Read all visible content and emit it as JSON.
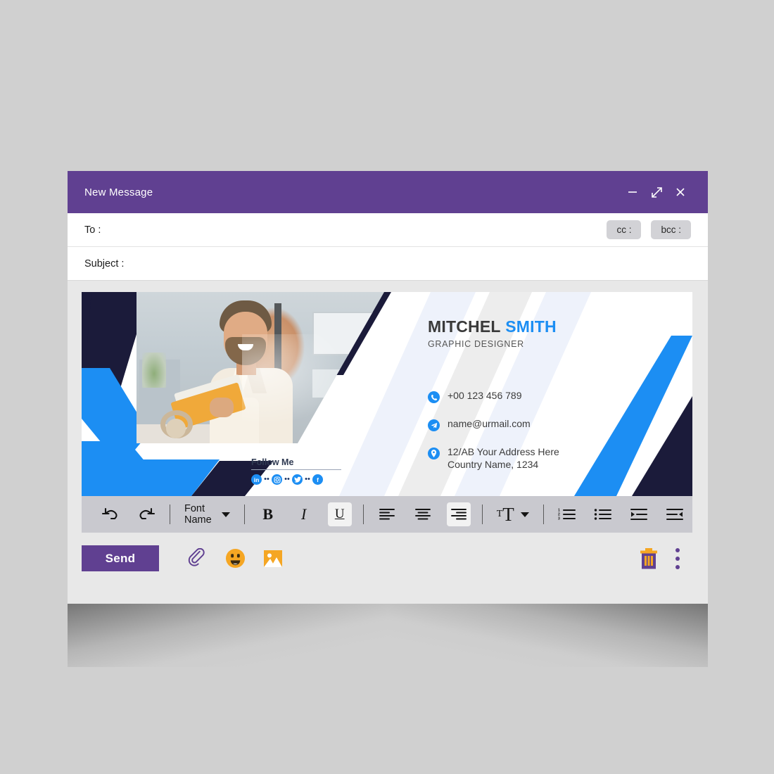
{
  "window": {
    "title": "New Message",
    "controls": [
      {
        "name": "minimize",
        "icon": "minimize-icon"
      },
      {
        "name": "expand",
        "icon": "expand-icon"
      },
      {
        "name": "close",
        "icon": "close-icon"
      }
    ]
  },
  "compose": {
    "to_label": "To :",
    "to_value": "",
    "to_placeholder": "",
    "cc_label": "cc :",
    "bcc_label": "bcc :",
    "subject_label": "Subject :",
    "subject_value": "",
    "subject_placeholder": ""
  },
  "signature": {
    "name_first": "MITCHEL",
    "name_last": "SMITH",
    "role": "GRAPHIC DESIGNER",
    "contacts": [
      {
        "icon": "phone-icon",
        "text": "+00 123 456 789"
      },
      {
        "icon": "send-telegram-icon",
        "text": "name@urmail.com"
      },
      {
        "icon": "location-pin-icon",
        "text": "12/AB Your Address Here"
      }
    ],
    "address_line2": "Country Name, 1234",
    "follow_label": "Follow Me",
    "social": [
      {
        "name": "linkedin-icon",
        "glyph": "in"
      },
      {
        "name": "instagram-icon",
        "glyph": ""
      },
      {
        "name": "twitter-icon",
        "glyph": ""
      },
      {
        "name": "facebook-icon",
        "glyph": "f"
      }
    ],
    "photo_alt": "man holding orange book smiling in office",
    "colors": {
      "navy": "#1b1b3a",
      "blue": "#1c8ef3",
      "accent_text": "#1c8ef3"
    }
  },
  "toolbar": {
    "undo_label": "undo-icon",
    "redo_label": "redo-icon",
    "font_name_label": "Font Name",
    "bold_label": "B",
    "italic_label": "I",
    "underline_label": "U",
    "align_left_label": "align-left-icon",
    "align_center_label": "align-center-icon",
    "align_right_label": "align-right-icon",
    "font_size_small": "T",
    "font_size_big": "T",
    "numbered_list_label": "numbered-list-icon",
    "bullet_list_label": "bullet-list-icon",
    "indent_label": "indent-icon",
    "outdent_label": "outdent-icon",
    "active": [
      "underline",
      "align-right"
    ]
  },
  "actions": {
    "send_label": "Send",
    "attach_label": "attach-icon",
    "emoji_label": "emoji-icon",
    "image_label": "image-icon",
    "delete_label": "trash-icon",
    "more_label": "more-options-icon"
  },
  "colors": {
    "header_purple": "#604091",
    "page_bg": "#d0d0d0",
    "toolbar_grey": "#c9c9cf",
    "orange": "#f5a623"
  }
}
